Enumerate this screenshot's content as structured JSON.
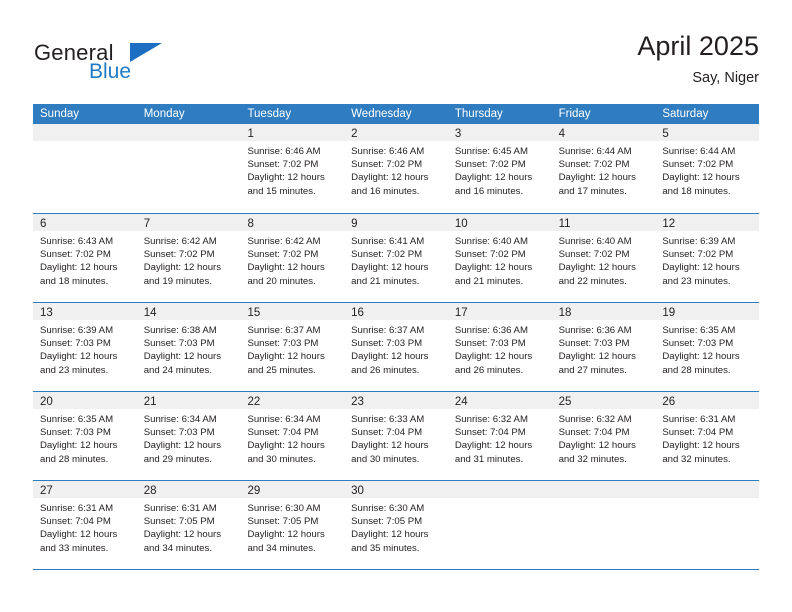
{
  "brand": {
    "name_part1": "General",
    "name_part2": "Blue",
    "logo_icon": "triangle-flag-icon"
  },
  "header": {
    "title": "April 2025",
    "subtitle": "Say, Niger"
  },
  "colors": {
    "header_blue": "#2f7dc0",
    "brand_blue": "#1f7ac4",
    "day_band_gray": "#f0f0f0",
    "text": "#231f20"
  },
  "calendar": {
    "weekdays": [
      "Sunday",
      "Monday",
      "Tuesday",
      "Wednesday",
      "Thursday",
      "Friday",
      "Saturday"
    ],
    "weeks": [
      [
        {
          "day": "",
          "sunrise": "",
          "sunset": "",
          "daylight_line1": "",
          "daylight_line2": ""
        },
        {
          "day": "",
          "sunrise": "",
          "sunset": "",
          "daylight_line1": "",
          "daylight_line2": ""
        },
        {
          "day": "1",
          "sunrise": "Sunrise: 6:46 AM",
          "sunset": "Sunset: 7:02 PM",
          "daylight_line1": "Daylight: 12 hours",
          "daylight_line2": "and 15 minutes."
        },
        {
          "day": "2",
          "sunrise": "Sunrise: 6:46 AM",
          "sunset": "Sunset: 7:02 PM",
          "daylight_line1": "Daylight: 12 hours",
          "daylight_line2": "and 16 minutes."
        },
        {
          "day": "3",
          "sunrise": "Sunrise: 6:45 AM",
          "sunset": "Sunset: 7:02 PM",
          "daylight_line1": "Daylight: 12 hours",
          "daylight_line2": "and 16 minutes."
        },
        {
          "day": "4",
          "sunrise": "Sunrise: 6:44 AM",
          "sunset": "Sunset: 7:02 PM",
          "daylight_line1": "Daylight: 12 hours",
          "daylight_line2": "and 17 minutes."
        },
        {
          "day": "5",
          "sunrise": "Sunrise: 6:44 AM",
          "sunset": "Sunset: 7:02 PM",
          "daylight_line1": "Daylight: 12 hours",
          "daylight_line2": "and 18 minutes."
        }
      ],
      [
        {
          "day": "6",
          "sunrise": "Sunrise: 6:43 AM",
          "sunset": "Sunset: 7:02 PM",
          "daylight_line1": "Daylight: 12 hours",
          "daylight_line2": "and 18 minutes."
        },
        {
          "day": "7",
          "sunrise": "Sunrise: 6:42 AM",
          "sunset": "Sunset: 7:02 PM",
          "daylight_line1": "Daylight: 12 hours",
          "daylight_line2": "and 19 minutes."
        },
        {
          "day": "8",
          "sunrise": "Sunrise: 6:42 AM",
          "sunset": "Sunset: 7:02 PM",
          "daylight_line1": "Daylight: 12 hours",
          "daylight_line2": "and 20 minutes."
        },
        {
          "day": "9",
          "sunrise": "Sunrise: 6:41 AM",
          "sunset": "Sunset: 7:02 PM",
          "daylight_line1": "Daylight: 12 hours",
          "daylight_line2": "and 21 minutes."
        },
        {
          "day": "10",
          "sunrise": "Sunrise: 6:40 AM",
          "sunset": "Sunset: 7:02 PM",
          "daylight_line1": "Daylight: 12 hours",
          "daylight_line2": "and 21 minutes."
        },
        {
          "day": "11",
          "sunrise": "Sunrise: 6:40 AM",
          "sunset": "Sunset: 7:02 PM",
          "daylight_line1": "Daylight: 12 hours",
          "daylight_line2": "and 22 minutes."
        },
        {
          "day": "12",
          "sunrise": "Sunrise: 6:39 AM",
          "sunset": "Sunset: 7:02 PM",
          "daylight_line1": "Daylight: 12 hours",
          "daylight_line2": "and 23 minutes."
        }
      ],
      [
        {
          "day": "13",
          "sunrise": "Sunrise: 6:39 AM",
          "sunset": "Sunset: 7:03 PM",
          "daylight_line1": "Daylight: 12 hours",
          "daylight_line2": "and 23 minutes."
        },
        {
          "day": "14",
          "sunrise": "Sunrise: 6:38 AM",
          "sunset": "Sunset: 7:03 PM",
          "daylight_line1": "Daylight: 12 hours",
          "daylight_line2": "and 24 minutes."
        },
        {
          "day": "15",
          "sunrise": "Sunrise: 6:37 AM",
          "sunset": "Sunset: 7:03 PM",
          "daylight_line1": "Daylight: 12 hours",
          "daylight_line2": "and 25 minutes."
        },
        {
          "day": "16",
          "sunrise": "Sunrise: 6:37 AM",
          "sunset": "Sunset: 7:03 PM",
          "daylight_line1": "Daylight: 12 hours",
          "daylight_line2": "and 26 minutes."
        },
        {
          "day": "17",
          "sunrise": "Sunrise: 6:36 AM",
          "sunset": "Sunset: 7:03 PM",
          "daylight_line1": "Daylight: 12 hours",
          "daylight_line2": "and 26 minutes."
        },
        {
          "day": "18",
          "sunrise": "Sunrise: 6:36 AM",
          "sunset": "Sunset: 7:03 PM",
          "daylight_line1": "Daylight: 12 hours",
          "daylight_line2": "and 27 minutes."
        },
        {
          "day": "19",
          "sunrise": "Sunrise: 6:35 AM",
          "sunset": "Sunset: 7:03 PM",
          "daylight_line1": "Daylight: 12 hours",
          "daylight_line2": "and 28 minutes."
        }
      ],
      [
        {
          "day": "20",
          "sunrise": "Sunrise: 6:35 AM",
          "sunset": "Sunset: 7:03 PM",
          "daylight_line1": "Daylight: 12 hours",
          "daylight_line2": "and 28 minutes."
        },
        {
          "day": "21",
          "sunrise": "Sunrise: 6:34 AM",
          "sunset": "Sunset: 7:03 PM",
          "daylight_line1": "Daylight: 12 hours",
          "daylight_line2": "and 29 minutes."
        },
        {
          "day": "22",
          "sunrise": "Sunrise: 6:34 AM",
          "sunset": "Sunset: 7:04 PM",
          "daylight_line1": "Daylight: 12 hours",
          "daylight_line2": "and 30 minutes."
        },
        {
          "day": "23",
          "sunrise": "Sunrise: 6:33 AM",
          "sunset": "Sunset: 7:04 PM",
          "daylight_line1": "Daylight: 12 hours",
          "daylight_line2": "and 30 minutes."
        },
        {
          "day": "24",
          "sunrise": "Sunrise: 6:32 AM",
          "sunset": "Sunset: 7:04 PM",
          "daylight_line1": "Daylight: 12 hours",
          "daylight_line2": "and 31 minutes."
        },
        {
          "day": "25",
          "sunrise": "Sunrise: 6:32 AM",
          "sunset": "Sunset: 7:04 PM",
          "daylight_line1": "Daylight: 12 hours",
          "daylight_line2": "and 32 minutes."
        },
        {
          "day": "26",
          "sunrise": "Sunrise: 6:31 AM",
          "sunset": "Sunset: 7:04 PM",
          "daylight_line1": "Daylight: 12 hours",
          "daylight_line2": "and 32 minutes."
        }
      ],
      [
        {
          "day": "27",
          "sunrise": "Sunrise: 6:31 AM",
          "sunset": "Sunset: 7:04 PM",
          "daylight_line1": "Daylight: 12 hours",
          "daylight_line2": "and 33 minutes."
        },
        {
          "day": "28",
          "sunrise": "Sunrise: 6:31 AM",
          "sunset": "Sunset: 7:05 PM",
          "daylight_line1": "Daylight: 12 hours",
          "daylight_line2": "and 34 minutes."
        },
        {
          "day": "29",
          "sunrise": "Sunrise: 6:30 AM",
          "sunset": "Sunset: 7:05 PM",
          "daylight_line1": "Daylight: 12 hours",
          "daylight_line2": "and 34 minutes."
        },
        {
          "day": "30",
          "sunrise": "Sunrise: 6:30 AM",
          "sunset": "Sunset: 7:05 PM",
          "daylight_line1": "Daylight: 12 hours",
          "daylight_line2": "and 35 minutes."
        },
        {
          "day": "",
          "sunrise": "",
          "sunset": "",
          "daylight_line1": "",
          "daylight_line2": ""
        },
        {
          "day": "",
          "sunrise": "",
          "sunset": "",
          "daylight_line1": "",
          "daylight_line2": ""
        },
        {
          "day": "",
          "sunrise": "",
          "sunset": "",
          "daylight_line1": "",
          "daylight_line2": ""
        }
      ]
    ]
  }
}
